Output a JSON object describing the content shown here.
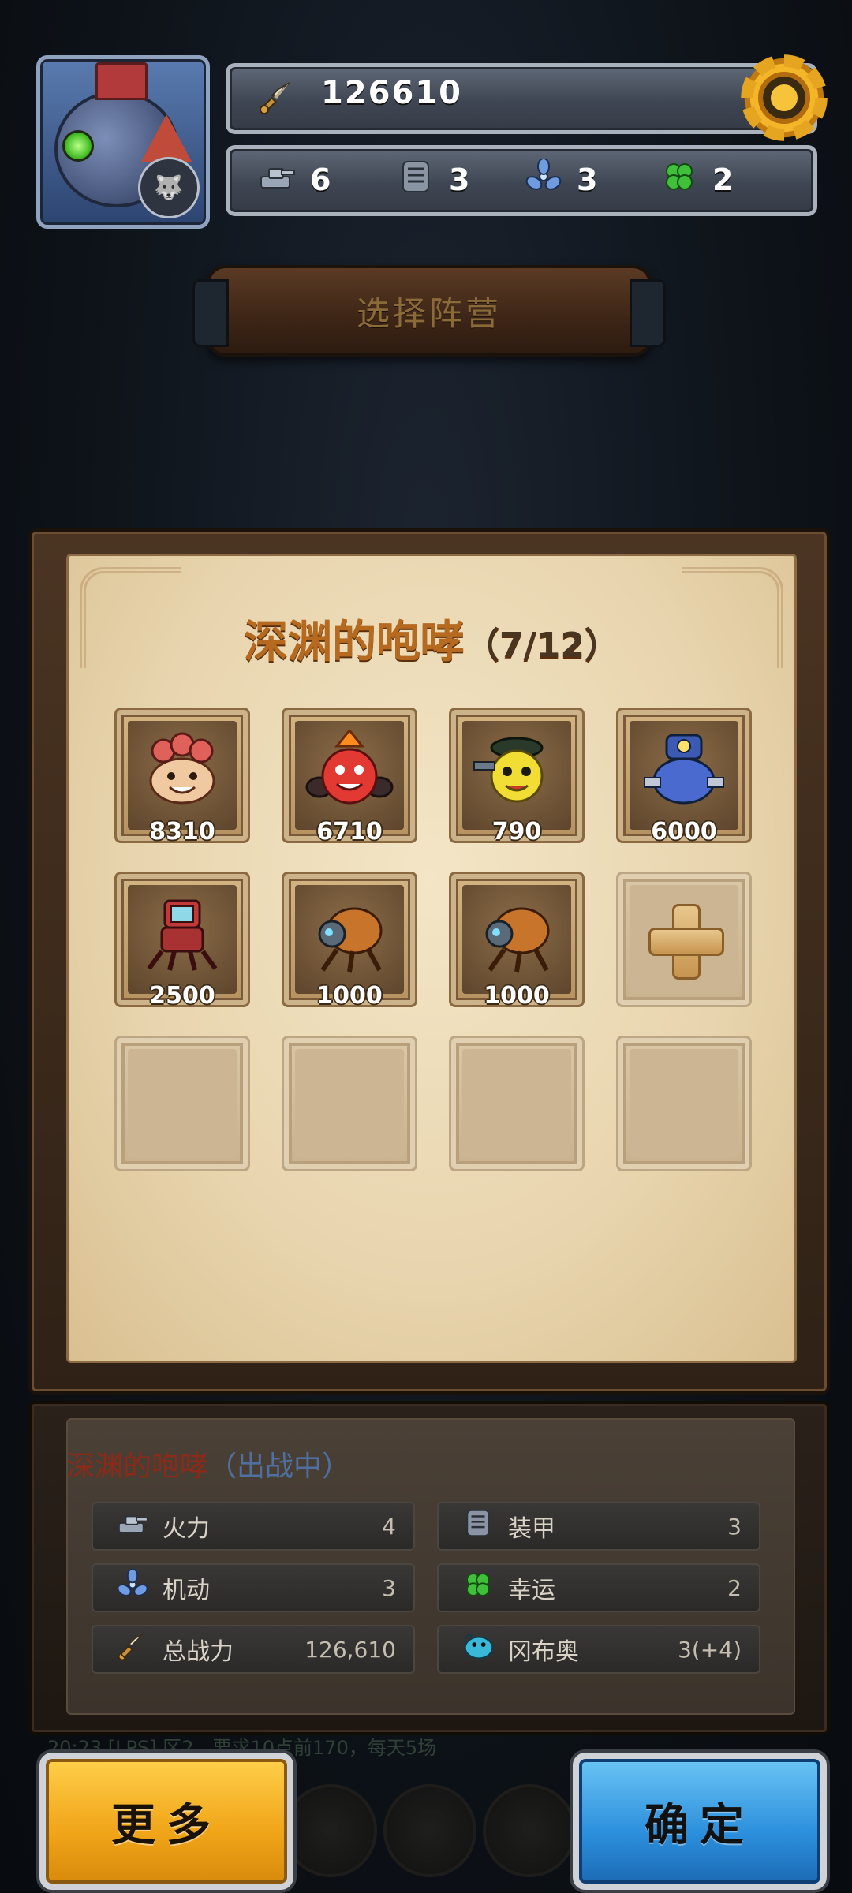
{
  "header": {
    "power_value": "126610",
    "stats": [
      {
        "icon": "tank-turret-icon",
        "value": "6"
      },
      {
        "icon": "armor-plate-icon",
        "value": "3"
      },
      {
        "icon": "propeller-icon",
        "value": "3"
      },
      {
        "icon": "clover-icon",
        "value": "2"
      }
    ]
  },
  "plank": {
    "title": "选择阵营"
  },
  "panel": {
    "name": "深渊的咆哮",
    "count": "（7/12）",
    "slots": [
      {
        "cost": "8310",
        "kind": "coral-crab",
        "color": "#e0605a"
      },
      {
        "cost": "6710",
        "kind": "red-fire",
        "color": "#e23a32"
      },
      {
        "cost": "790",
        "kind": "yellow-officer",
        "color": "#f2dd34"
      },
      {
        "cost": "6000",
        "kind": "blue-robot",
        "color": "#3c5ab4"
      },
      {
        "cost": "2500",
        "kind": "red-tv-mech",
        "color": "#c03a3a"
      },
      {
        "cost": "1000",
        "kind": "spider-bot",
        "color": "#c8742a"
      },
      {
        "cost": "1000",
        "kind": "spider-bot",
        "color": "#c8742a"
      }
    ]
  },
  "info": {
    "name": "深渊的咆哮",
    "status": "（出战中）",
    "rows": [
      {
        "icon": "tank-turret-icon",
        "label": "火力",
        "value": "4"
      },
      {
        "icon": "armor-plate-icon",
        "label": "装甲",
        "value": "3"
      },
      {
        "icon": "propeller-icon",
        "label": "机动",
        "value": "3"
      },
      {
        "icon": "clover-icon",
        "label": "幸运",
        "value": "2"
      },
      {
        "icon": "sword-icon",
        "label": "总战力",
        "value": "126,610"
      },
      {
        "icon": "fish-pet-icon",
        "label": "冈布奥",
        "value": "3(+4)"
      }
    ]
  },
  "ticker": "20:23 [LPS] 区2，要求10点前170，每天5场",
  "buttons": {
    "more": "更多",
    "confirm": "确定"
  }
}
